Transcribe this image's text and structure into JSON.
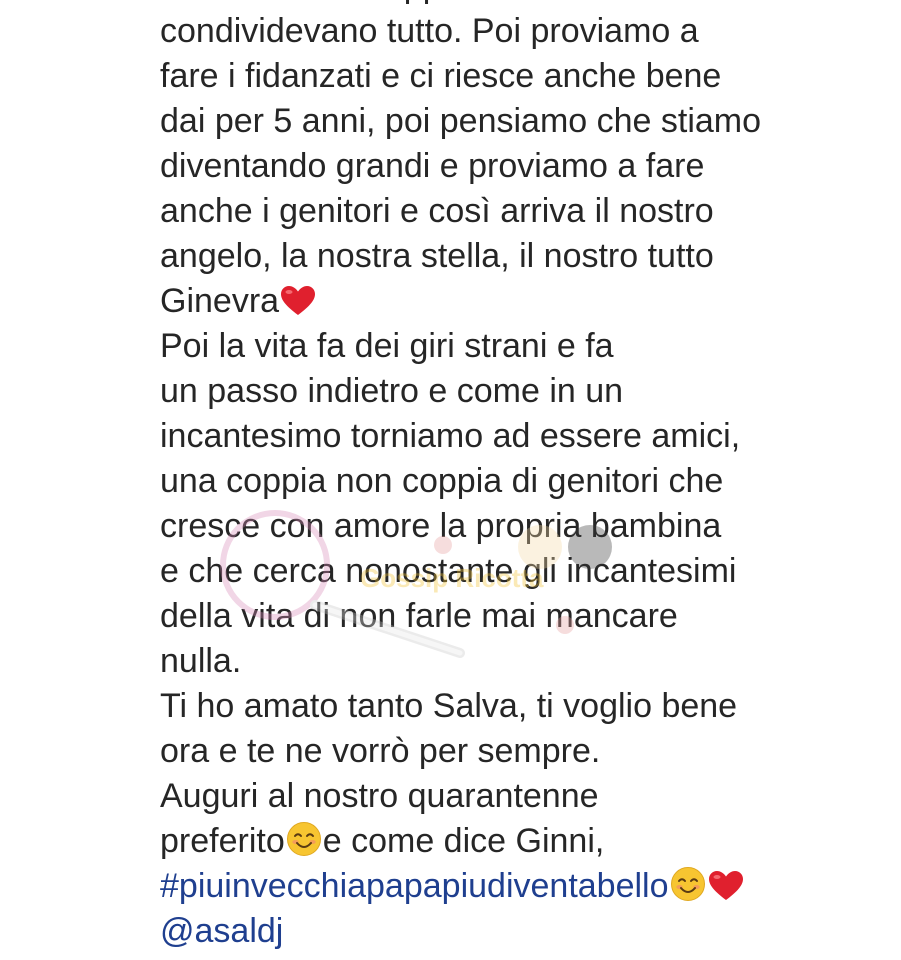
{
  "caption": {
    "lines": [
      "eravamo una coppia di amici che",
      "condividevano tutto. Poi proviamo a",
      "fare i fidanzati e ci riesce anche bene",
      "dai per 5 anni, poi pensiamo che stiamo",
      "diventando grandi e proviamo a fare",
      "anche i genitori e così arriva il nostro",
      "angelo, la nostra stella, il nostro tutto",
      "Ginevra",
      "Poi la vita fa dei giri strani e fa",
      "un passo indietro e come in un",
      "incantesimo torniamo ad essere amici,",
      "una coppia non coppia di genitori che",
      "cresce con amore la propria bambina",
      "e che cerca nonostante gli incantesimi",
      "della vita di non farle mai mancare",
      "nulla.",
      "Ti ho amato tanto Salva, ti voglio bene",
      "ora e te ne vorrò per sempre.",
      "Auguri al nostro quarantenne",
      "preferito",
      "e come dice Ginni,"
    ],
    "hashtag": "#piuinvecchiapapapiudiventabello",
    "mention": "@asaldj"
  },
  "emoji": {
    "heart": "heart-emoji",
    "smile": "smiling-face-emoji"
  },
  "colors": {
    "text": "#262626",
    "link": "#1f3f8f",
    "heart": "#e0202e",
    "smile": "#f7c531"
  },
  "watermark": {
    "text": "Gossip Ricotta"
  }
}
